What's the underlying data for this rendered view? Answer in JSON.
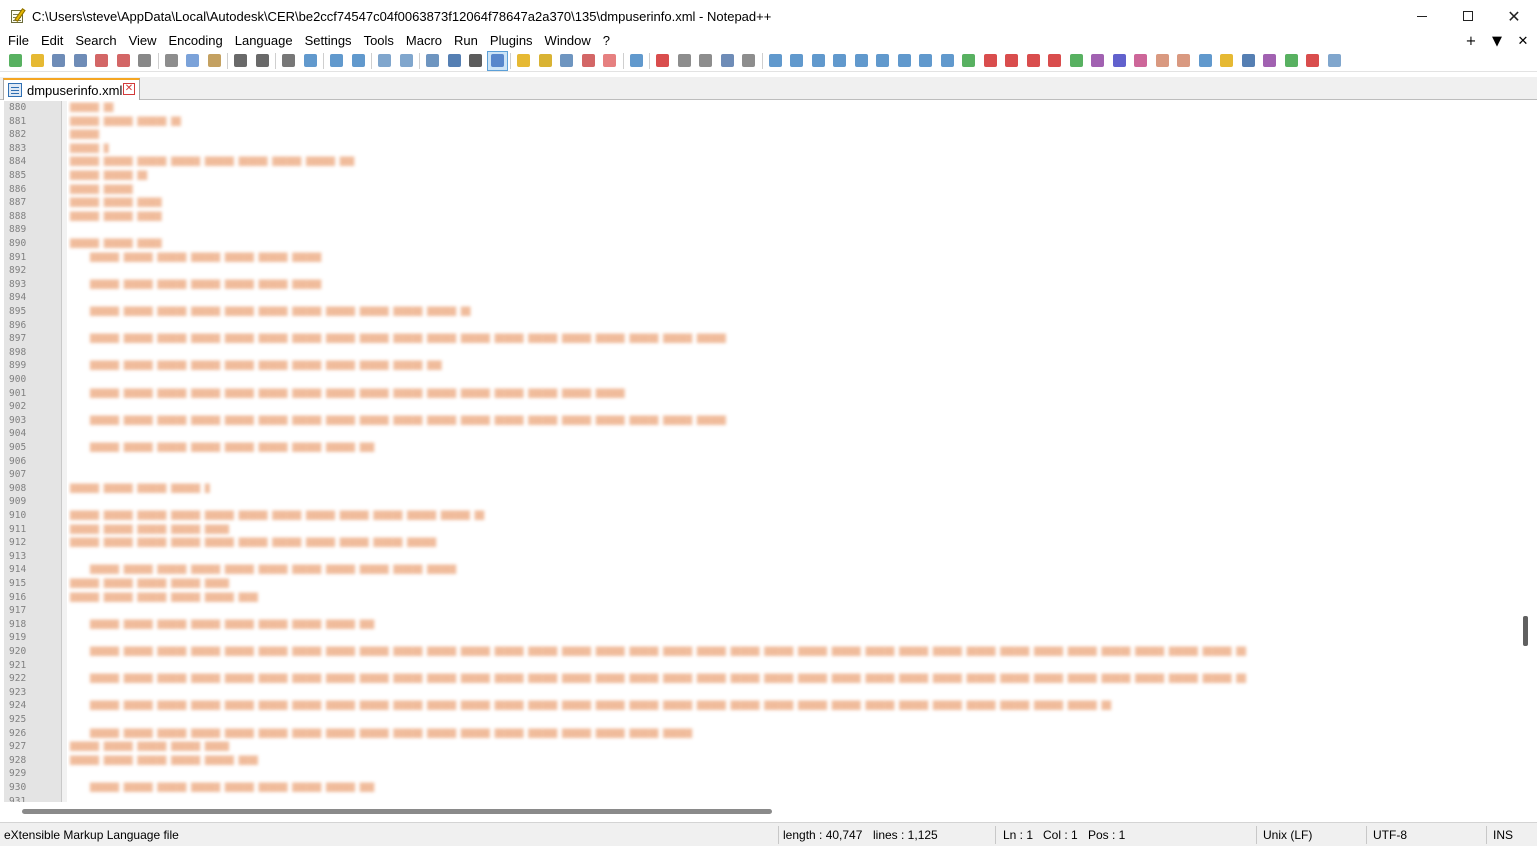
{
  "window": {
    "title": "C:\\Users\\steve\\AppData\\Local\\Autodesk\\CER\\be2ccf74547c04f0063873f12064f78647a2a370\\135\\dmpuserinfo.xml - Notepad++",
    "minimize": "–",
    "close": "✕"
  },
  "menu": {
    "items": [
      "File",
      "Edit",
      "Search",
      "View",
      "Encoding",
      "Language",
      "Settings",
      "Tools",
      "Macro",
      "Run",
      "Plugins",
      "Window",
      "?"
    ],
    "right": [
      "+",
      "▼",
      "✕"
    ]
  },
  "toolbar": {
    "icons": [
      {
        "name": "new-file-icon",
        "color": "#2e9e3a"
      },
      {
        "name": "open-file-icon",
        "color": "#e0a800"
      },
      {
        "name": "save-icon",
        "color": "#4a6fa5"
      },
      {
        "name": "save-all-icon",
        "color": "#4a6fa5"
      },
      {
        "name": "close-icon",
        "color": "#c84040"
      },
      {
        "name": "close-all-icon",
        "color": "#c84040"
      },
      {
        "name": "print-icon",
        "color": "#6a6a6a"
      },
      {
        "sep": true
      },
      {
        "name": "cut-icon",
        "color": "#707070"
      },
      {
        "name": "copy-icon",
        "color": "#5a8bd0"
      },
      {
        "name": "paste-icon",
        "color": "#b58a3a"
      },
      {
        "sep": true
      },
      {
        "name": "undo-icon",
        "color": "#444444"
      },
      {
        "name": "redo-icon",
        "color": "#444444"
      },
      {
        "sep": true
      },
      {
        "name": "find-icon",
        "color": "#555555"
      },
      {
        "name": "replace-icon",
        "color": "#3a7fc0"
      },
      {
        "sep": true
      },
      {
        "name": "zoom-in-icon",
        "color": "#3a7fc0"
      },
      {
        "name": "zoom-out-icon",
        "color": "#3a7fc0"
      },
      {
        "sep": true
      },
      {
        "name": "sync-vertical-icon",
        "color": "#6090c0"
      },
      {
        "name": "sync-horizontal-icon",
        "color": "#6090c0"
      },
      {
        "sep": true
      },
      {
        "name": "word-wrap-icon",
        "color": "#4a7ab0"
      },
      {
        "name": "show-all-chars-icon",
        "color": "#2a5fa0"
      },
      {
        "name": "dropdown-arrow-icon",
        "color": "#333333"
      },
      {
        "name": "indent-guide-icon",
        "color": "#3a6fc0",
        "active": true
      },
      {
        "sep": true
      },
      {
        "name": "udl-icon",
        "color": "#e0a800"
      },
      {
        "name": "doc-map-icon",
        "color": "#d0a000"
      },
      {
        "name": "function-list-icon",
        "color": "#4a7ab0"
      },
      {
        "name": "folder-as-workspace-icon",
        "color": "#c84040"
      },
      {
        "name": "monitoring-icon",
        "color": "#e06060"
      },
      {
        "sep": true
      },
      {
        "name": "eye-icon",
        "color": "#3a7fc0"
      },
      {
        "sep": true
      },
      {
        "name": "record-macro-icon",
        "color": "#d02020"
      },
      {
        "name": "stop-record-icon",
        "color": "#707070"
      },
      {
        "name": "play-macro-icon",
        "color": "#707070"
      },
      {
        "name": "run-macro-multiple-icon",
        "color": "#4a6fa5"
      },
      {
        "name": "save-macro-icon",
        "color": "#707070"
      },
      {
        "sep": true
      },
      {
        "name": "plugin-a-icon",
        "color": "#3a7fc0"
      },
      {
        "name": "plugin-b-icon",
        "color": "#3a7fc0"
      },
      {
        "name": "plugin-c-icon",
        "color": "#3a7fc0"
      },
      {
        "name": "plugin-d-icon",
        "color": "#3a7fc0"
      },
      {
        "name": "arrow-up-icon",
        "color": "#3a7fc0"
      },
      {
        "name": "arrow-down-icon",
        "color": "#3a7fc0"
      },
      {
        "name": "plugin-e-icon",
        "color": "#3a7fc0"
      },
      {
        "name": "plugin-f-icon",
        "color": "#3a7fc0"
      },
      {
        "name": "plugin-g-icon",
        "color": "#3a7fc0"
      },
      {
        "name": "checkmark-icon",
        "color": "#2e9e3a"
      },
      {
        "name": "first-icon",
        "color": "#d02020"
      },
      {
        "name": "prev-icon",
        "color": "#d02020"
      },
      {
        "name": "next-icon",
        "color": "#d02020"
      },
      {
        "name": "last-icon",
        "color": "#d02020"
      },
      {
        "name": "plugin-h-icon",
        "color": "#2e9e3a"
      },
      {
        "name": "plugin-i-icon",
        "color": "#8a3a9e"
      },
      {
        "name": "plugin-j-icon",
        "color": "#3a3ac0"
      },
      {
        "name": "plugin-k-icon",
        "color": "#c04080"
      },
      {
        "name": "plugin-l-icon",
        "color": "#d08060"
      },
      {
        "name": "plugin-m-icon",
        "color": "#d08060"
      },
      {
        "name": "plugin-n-icon",
        "color": "#3a7fc0"
      },
      {
        "name": "plugin-o-icon",
        "color": "#e0a800"
      },
      {
        "name": "ampersand-icon",
        "color": "#2a5fa0"
      },
      {
        "name": "plugin-p-icon",
        "color": "#8a3a9e"
      },
      {
        "name": "plugin-q-icon",
        "color": "#2e9e3a"
      },
      {
        "name": "plugin-r-icon",
        "color": "#d02020"
      },
      {
        "name": "plugin-s-icon",
        "color": "#6090c0"
      }
    ]
  },
  "tab": {
    "label": "dmpuserinfo.xml",
    "close": "✕"
  },
  "editor": {
    "first_line": 880,
    "line_count": 52
  },
  "status": {
    "file_type": "eXtensible Markup Language file",
    "length": "length : 40,747",
    "lines": "lines : 1,125",
    "ln": "Ln : 1",
    "col": "Col : 1",
    "pos": "Pos : 1",
    "eol": "Unix (LF)",
    "encoding": "UTF-8",
    "mode": "INS"
  }
}
